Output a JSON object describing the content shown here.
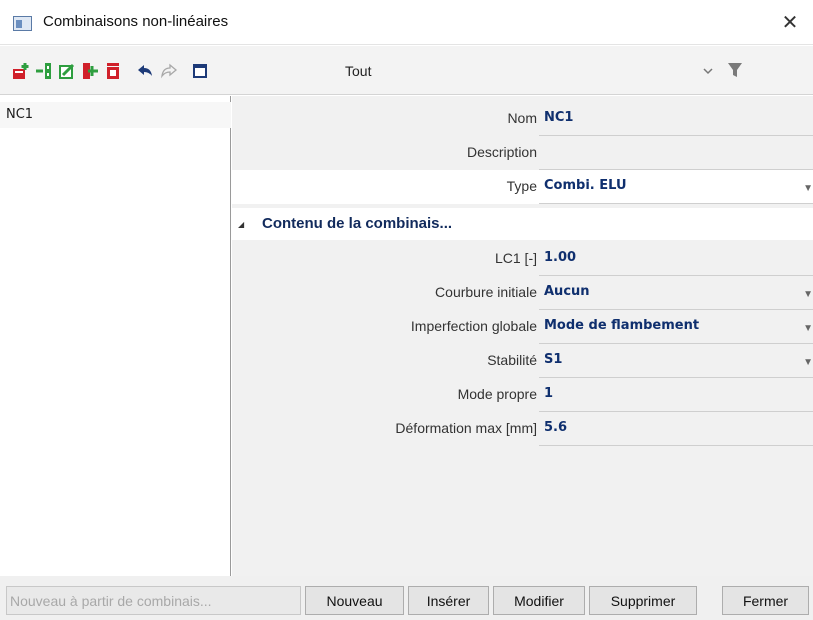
{
  "window": {
    "title": "Combinaisons non-linéaires",
    "close_symbol": "✕"
  },
  "toolbar": {
    "icons": [
      "new-icon",
      "insert-icon",
      "edit-icon",
      "copy-icon",
      "delete-icon",
      "undo-icon",
      "redo-icon",
      "table-view-icon"
    ],
    "filter_label": "Tout",
    "filter_icons": [
      "chevron-down-icon",
      "funnel-icon"
    ]
  },
  "list": {
    "items": [
      {
        "label": "NC1"
      }
    ]
  },
  "properties": {
    "nom": {
      "label": "Nom",
      "value": "NC1"
    },
    "description": {
      "label": "Description",
      "value": ""
    },
    "type": {
      "label": "Type",
      "value": "Combi. ELU"
    },
    "section_title": "Contenu de la combinais...",
    "lc1": {
      "label": "LC1 [-]",
      "value": "1.00"
    },
    "courbure": {
      "label": "Courbure initiale",
      "value": "Aucun"
    },
    "imperfection": {
      "label": "Imperfection globale",
      "value": "Mode de flambement"
    },
    "stabilite": {
      "label": "Stabilité",
      "value": "S1"
    },
    "mode_propre": {
      "label": "Mode propre",
      "value": "1"
    },
    "deformation": {
      "label": "Déformation max [mm]",
      "value": "5.6"
    }
  },
  "buttons": {
    "nouveau_partir": "Nouveau à partir de combinais...",
    "nouveau": "Nouveau",
    "inserer": "Insérer",
    "modifier": "Modifier",
    "supprimer": "Supprimer",
    "fermer": "Fermer"
  },
  "colors": {
    "value_text": "#0f2f6e",
    "icon_green": "#2e9e3f",
    "icon_red": "#d0202a",
    "icon_navy": "#1d3a78"
  }
}
